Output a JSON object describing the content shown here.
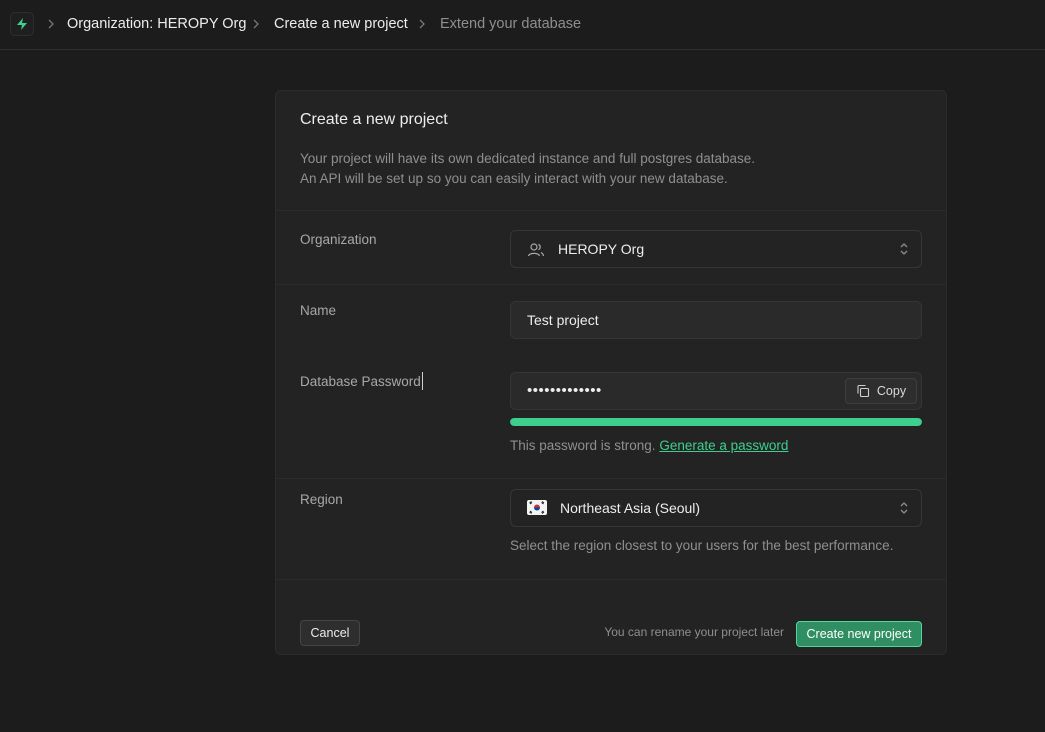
{
  "breadcrumbs": [
    {
      "label": "Organization: HEROPY Org"
    },
    {
      "label": "Create a new project"
    },
    {
      "label": "Extend your database"
    }
  ],
  "card": {
    "title": "Create a new project",
    "description_line1": "Your project will have its own dedicated instance and full postgres database.",
    "description_line2": "An API will be set up so you can easily interact with your new database."
  },
  "form": {
    "organization": {
      "label": "Organization",
      "value": "HEROPY Org",
      "icon": "users-icon"
    },
    "name": {
      "label": "Name",
      "value": "Test project"
    },
    "password": {
      "label": "Database Password",
      "value": "•••••••••••••",
      "copy_label": "Copy",
      "strength_fraction": 1.0,
      "hint": "This password is strong.",
      "generate_link": "Generate a password"
    },
    "region": {
      "label": "Region",
      "value": "Northeast Asia (Seoul)",
      "flag": "south-korea-flag",
      "hint": "Select the region closest to your users for the best performance."
    }
  },
  "footer": {
    "cancel_label": "Cancel",
    "note": "You can rename your project later",
    "create_label": "Create new project"
  },
  "colors": {
    "background": "#1c1c1c",
    "card": "#232323",
    "accent": "#3ecf8e"
  }
}
